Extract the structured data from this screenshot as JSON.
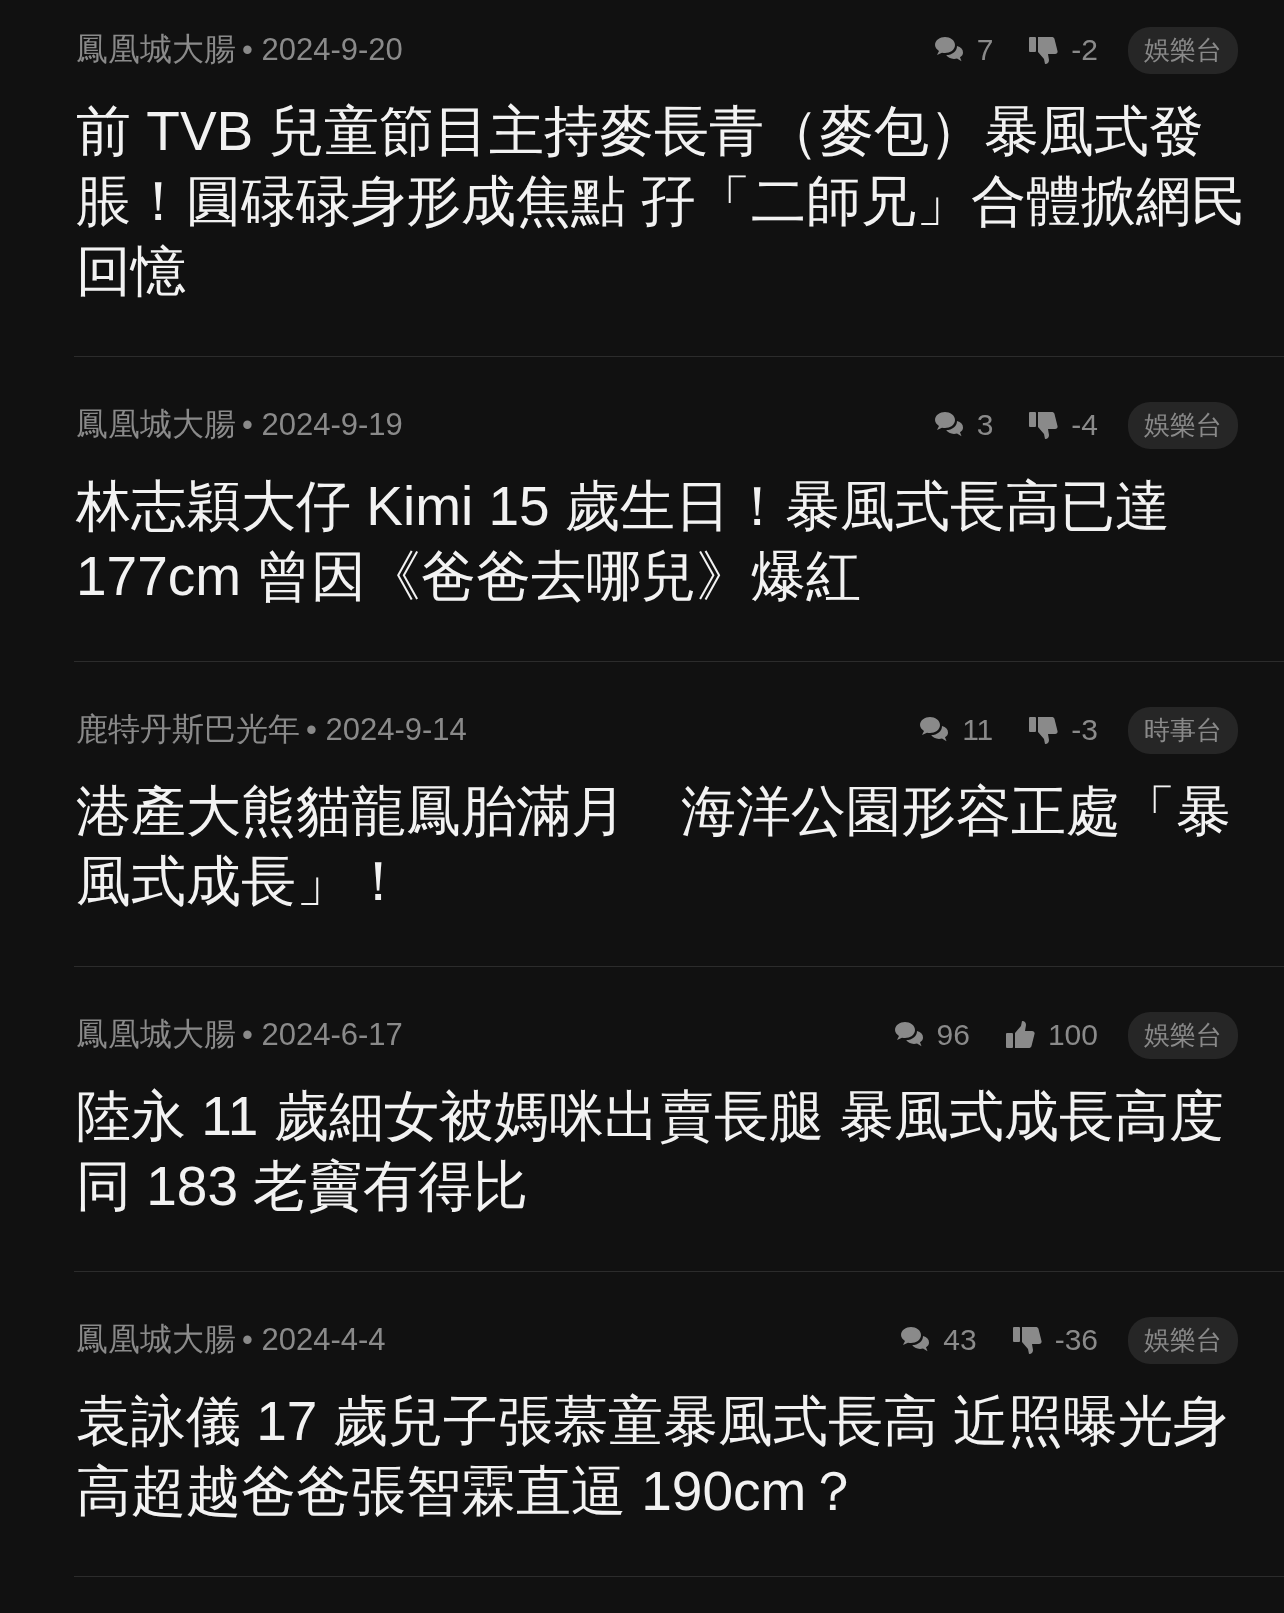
{
  "posts": [
    {
      "author": "鳳凰城大腸",
      "date": "• 2024-9-20",
      "comments": "7",
      "vote": {
        "kind": "down",
        "count": "-2"
      },
      "tag": "娛樂台",
      "title": "前 TVB 兒童節目主持麥長青（麥包）暴風式發脹！圓碌碌身形成焦點 孖「二師兄」合體掀網民回憶"
    },
    {
      "author": "鳳凰城大腸",
      "date": "• 2024-9-19",
      "comments": "3",
      "vote": {
        "kind": "down",
        "count": "-4"
      },
      "tag": "娛樂台",
      "title": "林志穎大仔 Kimi 15 歲生日！暴風式長高已達 177cm 曾因《爸爸去哪兒》爆紅"
    },
    {
      "author": "鹿特丹斯巴光年",
      "date": "• 2024-9-14",
      "comments": "11",
      "vote": {
        "kind": "down",
        "count": "-3"
      },
      "tag": "時事台",
      "title": "港產大熊貓龍鳳胎滿月　海洋公園形容正處「暴風式成長」！"
    },
    {
      "author": "鳳凰城大腸",
      "date": "• 2024-6-17",
      "comments": "96",
      "vote": {
        "kind": "up",
        "count": "100"
      },
      "tag": "娛樂台",
      "title": "陸永 11 歲細女被媽咪出賣長腿 暴風式成長高度同 183 老竇有得比"
    },
    {
      "author": "鳳凰城大腸",
      "date": "• 2024-4-4",
      "comments": "43",
      "vote": {
        "kind": "down",
        "count": "-36"
      },
      "tag": "娛樂台",
      "title": "袁詠儀 17 歲兒子張慕童暴風式長高 近照曝光身高超越爸爸張智霖直逼 190cm？"
    }
  ]
}
